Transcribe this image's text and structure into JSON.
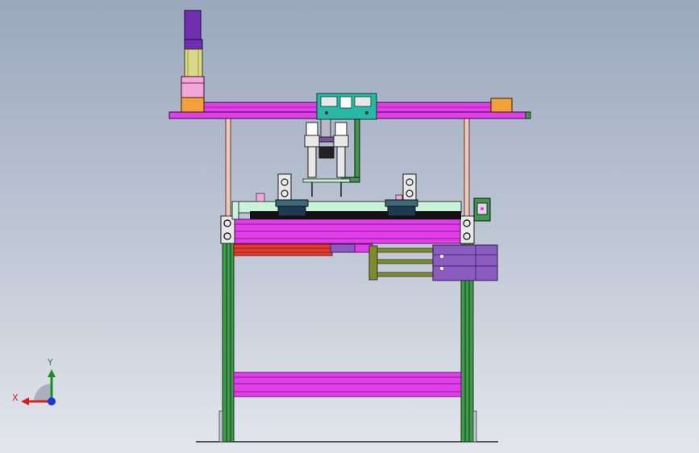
{
  "viewport": {
    "background_top": "#9aa7bd",
    "background_bottom": "#e3e6ec"
  },
  "colors": {
    "magenta": "#e03ee8",
    "magenta_dark": "#8e1a96",
    "purple": "#8a5cc0",
    "frame_green": "#3d9a4a",
    "frame_dark": "#1b3a1e",
    "teal": "#29b8a6",
    "orange": "#f2a13a",
    "mint": "#c9f3d9",
    "olive": "#7f8a2a",
    "red": "#e23a2c",
    "post": "#f0c7b8"
  },
  "icons": {
    "triad": "coordinate-triad-icon"
  },
  "triad": {
    "x_label": "X",
    "y_label": "Y"
  }
}
